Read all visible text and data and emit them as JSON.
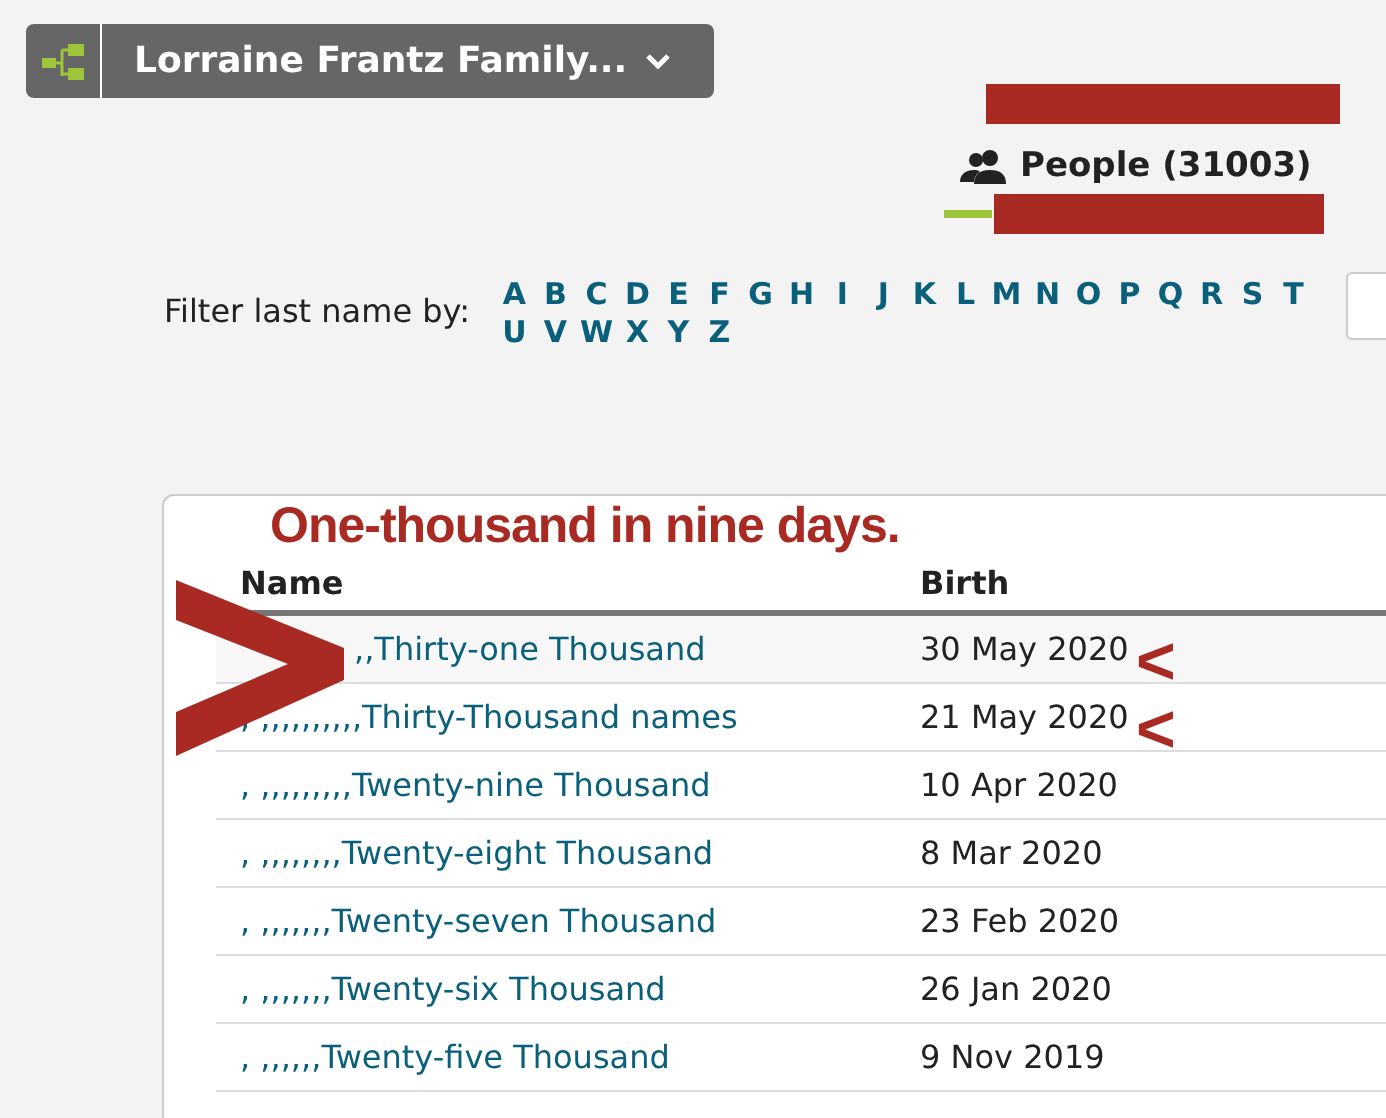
{
  "tree_button": {
    "label": "Lorraine Frantz Family..."
  },
  "people_tab": {
    "label": "People (31003)",
    "selected": true
  },
  "filter": {
    "label": "Filter last name by:",
    "letters": [
      "A",
      "B",
      "C",
      "D",
      "E",
      "F",
      "G",
      "H",
      "I",
      "J",
      "K",
      "L",
      "M",
      "N",
      "O",
      "P",
      "Q",
      "R",
      "S",
      "T",
      "U",
      "V",
      "W",
      "X",
      "Y",
      "Z"
    ]
  },
  "table": {
    "columns": [
      "Name",
      "Birth"
    ],
    "rows": [
      {
        "name": ",,Thirty-one Thousand",
        "birth": "30 May 2020"
      },
      {
        "name": ", ,,,,,,,,,,Thirty-Thousand names",
        "birth": "21 May 2020"
      },
      {
        "name": ", ,,,,,,,,,Twenty-nine Thousand",
        "birth": "10 Apr 2020"
      },
      {
        "name": ", ,,,,,,,,Twenty-eight Thousand",
        "birth": "8 Mar 2020"
      },
      {
        "name": ", ,,,,,,,Twenty-seven Thousand",
        "birth": "23 Feb 2020"
      },
      {
        "name": ", ,,,,,,,Twenty-six Thousand",
        "birth": "26 Jan 2020"
      },
      {
        "name": ", ,,,,,,Twenty-five Thousand",
        "birth": "9 Nov 2019"
      }
    ]
  },
  "annotation": {
    "headline": "One-thousand in nine days.",
    "marks": [
      "<",
      "<"
    ]
  }
}
